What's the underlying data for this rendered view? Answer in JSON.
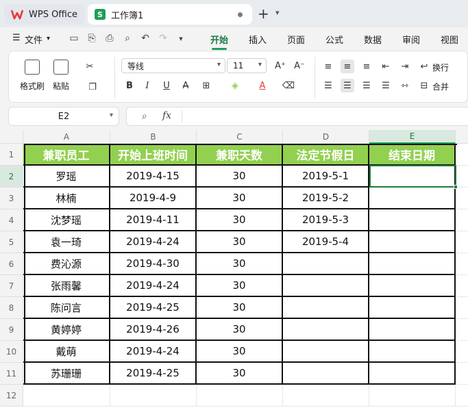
{
  "tabs": {
    "app_label": "WPS Office",
    "doc_label": "工作簿1",
    "doc_icon_letter": "S",
    "new_tab_symbol": "+"
  },
  "menu": {
    "file_label": "文件",
    "ribbon_tabs": [
      "开始",
      "插入",
      "页面",
      "公式",
      "数据",
      "审阅",
      "视图"
    ],
    "active_tab": "开始"
  },
  "ribbon": {
    "format_painter": "格式刷",
    "paste": "粘贴",
    "font_name": "等线",
    "font_size": "11",
    "wrap_text": "换行",
    "merge": "合并"
  },
  "formula_bar": {
    "name_box": "E2",
    "fx_label": "fx",
    "formula": ""
  },
  "sheet": {
    "columns": [
      "A",
      "B",
      "C",
      "D",
      "E"
    ],
    "row_numbers": [
      "1",
      "2",
      "3",
      "4",
      "5",
      "6",
      "7",
      "8",
      "9",
      "10",
      "11",
      "12"
    ],
    "selected_column": "E",
    "selected_row": "2",
    "header": [
      "兼职员工",
      "开始上班时间",
      "兼职天数",
      "法定节假日",
      "结束日期"
    ],
    "rows": [
      [
        "罗瑶",
        "2019-4-15",
        "30",
        "2019-5-1",
        ""
      ],
      [
        "林楠",
        "2019-4-9",
        "30",
        "2019-5-2",
        ""
      ],
      [
        "沈梦瑶",
        "2019-4-11",
        "30",
        "2019-5-3",
        ""
      ],
      [
        "袁一琦",
        "2019-4-24",
        "30",
        "2019-5-4",
        ""
      ],
      [
        "费沁源",
        "2019-4-30",
        "30",
        "",
        ""
      ],
      [
        "张雨馨",
        "2019-4-24",
        "30",
        "",
        ""
      ],
      [
        "陈问言",
        "2019-4-25",
        "30",
        "",
        ""
      ],
      [
        "黄婷婷",
        "2019-4-26",
        "30",
        "",
        ""
      ],
      [
        "戴萌",
        "2019-4-24",
        "30",
        "",
        ""
      ],
      [
        "苏珊珊",
        "2019-4-25",
        "30",
        "",
        ""
      ]
    ],
    "header_fill_color": "#92d050",
    "selection_color": "#1e7a3c"
  }
}
